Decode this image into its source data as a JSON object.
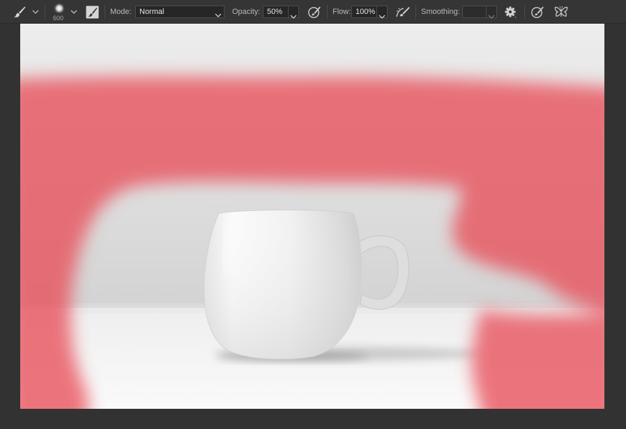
{
  "toolbar": {
    "tool_icon": "paintbrush-icon",
    "brush_size": "600",
    "mode_label": "Mode:",
    "mode_value": "Normal",
    "opacity_label": "Opacity:",
    "opacity_value": "50%",
    "pressure_opacity_icon": "pen-pressure-opacity-icon",
    "flow_label": "Flow:",
    "flow_value": "100%",
    "airbrush_icon": "airbrush-icon",
    "smoothing_label": "Smoothing:",
    "smoothing_value": "",
    "settings_icon": "gear-icon",
    "pressure_size_icon": "pen-pressure-size-icon",
    "symmetry_icon": "butterfly-symmetry-icon"
  },
  "canvas": {
    "subject": "white-mug-photo",
    "mask_overlay_color": "#e8505a",
    "mask_overlay_opacity": 0.5
  }
}
